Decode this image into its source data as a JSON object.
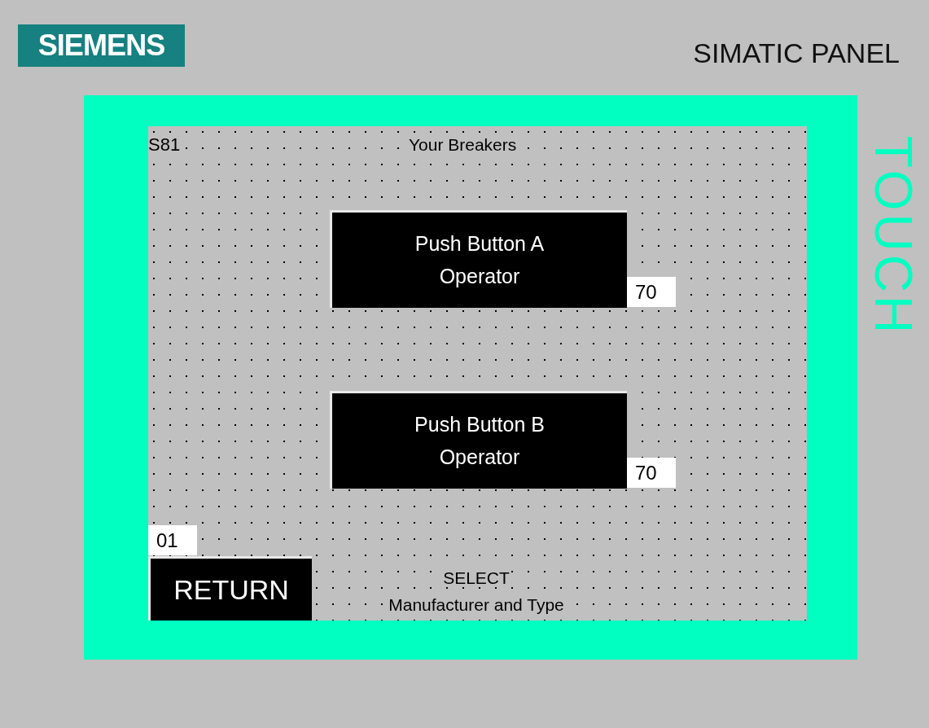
{
  "logo": "SIEMENS",
  "panel_title": "SIMATIC PANEL",
  "side_label": "TOUCH",
  "screen": {
    "screen_number": "S81",
    "title": "Your Breakers",
    "buttons": [
      {
        "lines": [
          "Push Button A",
          "Operator"
        ],
        "value": "70"
      },
      {
        "lines": [
          "Push Button B",
          "Operator"
        ],
        "value": "70"
      }
    ],
    "return_button": {
      "label": "RETURN",
      "number": "01"
    },
    "footer_lines": [
      "SELECT",
      "Manufacturer and Type"
    ]
  }
}
